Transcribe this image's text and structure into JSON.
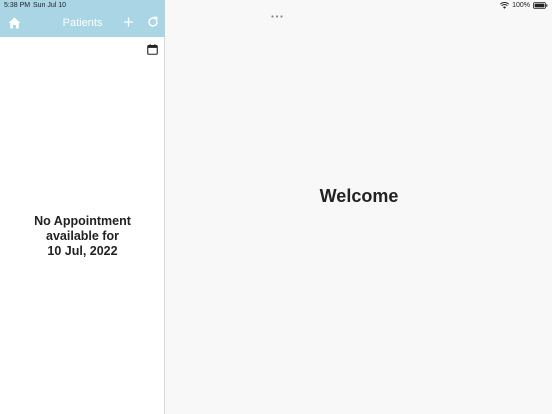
{
  "status_bar": {
    "time": "5:38 PM",
    "date": "Sun Jul 10",
    "battery": "100%"
  },
  "sidebar": {
    "title": "Patients",
    "add_icon": "plus-icon",
    "home_icon": "home-icon",
    "refresh_icon": "refresh-icon",
    "calendar_icon": "calendar-icon",
    "empty_line1": "No Appointment",
    "empty_line2": "available for",
    "empty_line3": "10 Jul, 2022"
  },
  "main": {
    "welcome": "Welcome"
  },
  "colors": {
    "header_bg": "#a9d5e4",
    "text": "#222222",
    "main_bg": "#f8f8f8"
  }
}
